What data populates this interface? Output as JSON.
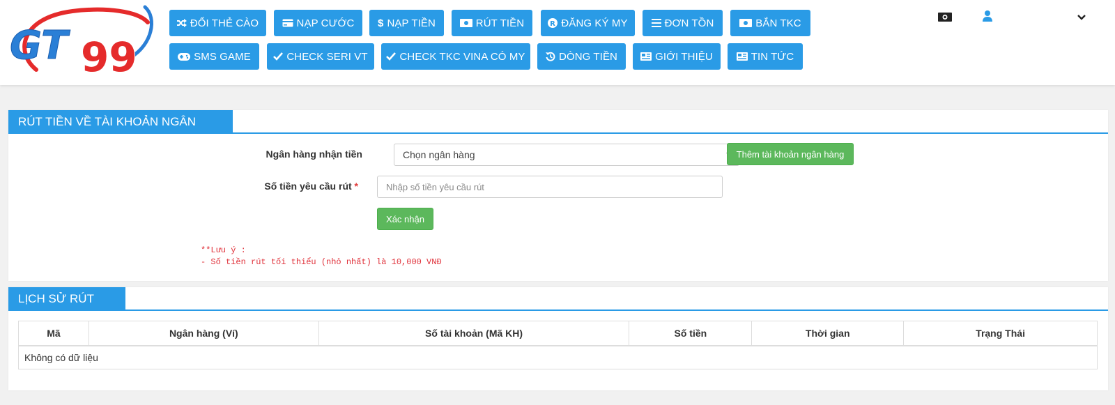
{
  "colors": {
    "primary": "#2a9be6",
    "success": "#5cb85c",
    "danger": "#e0313a"
  },
  "logo": {
    "text_gt": "GT",
    "text_99": "99"
  },
  "nav": {
    "row1": [
      {
        "label": "ĐỔI THẺ CÀO",
        "icon": "shuffle-icon"
      },
      {
        "label": "NẠP CƯỚC",
        "icon": "credit-card-icon"
      },
      {
        "label": "NẠP TIỀN",
        "icon": "dollar-icon"
      },
      {
        "label": "RÚT TIỀN",
        "icon": "money-bill-icon"
      },
      {
        "label": "ĐĂNG KÝ MY",
        "icon": "registered-icon"
      },
      {
        "label": "ĐƠN TỒN",
        "icon": "list-icon"
      },
      {
        "label": "BẮN TKC",
        "icon": "money-bill-icon"
      }
    ],
    "row2": [
      {
        "label": "SMS GAME",
        "icon": "gamepad-icon"
      },
      {
        "label": "CHECK SERI VT",
        "icon": "check-icon"
      },
      {
        "label": "CHECK TKC VINA CÓ MY",
        "icon": "check-icon"
      },
      {
        "label": "DÒNG TIỀN",
        "icon": "history-icon"
      },
      {
        "label": "GIỚI THIỆU",
        "icon": "newspaper-icon"
      },
      {
        "label": "TIN TỨC",
        "icon": "newspaper-icon"
      }
    ]
  },
  "header_right": {
    "wallet_icon": "money-bill-icon",
    "user_icon": "user-icon",
    "dropdown_icon": "chevron-down-icon"
  },
  "withdraw": {
    "title": "RÚT TIỀN VỀ TÀI KHOẢN NGÂN HÀNG",
    "bank_label": "Ngân hàng nhận tiền",
    "bank_selected": "Chọn ngân hàng",
    "add_bank_button": "Thêm tài khoản ngân hàng",
    "amount_label": "Số tiền yêu cầu rút",
    "amount_required": "*",
    "amount_placeholder": "Nhập số tiền yêu cầu rút",
    "confirm_button": "Xác nhận",
    "note_line1": "**Lưu ý :",
    "note_line2": "- Số tiền rút tối thiểu (nhỏ nhất) là 10,000 VNĐ"
  },
  "history": {
    "title": "LỊCH SỬ RÚT TIỀN",
    "columns": [
      "Mã",
      "Ngân hàng (Ví)",
      "Số tài khoản (Mã KH)",
      "Số tiền",
      "Thời gian",
      "Trạng Thái"
    ],
    "empty_text": "Không có dữ liệu"
  }
}
